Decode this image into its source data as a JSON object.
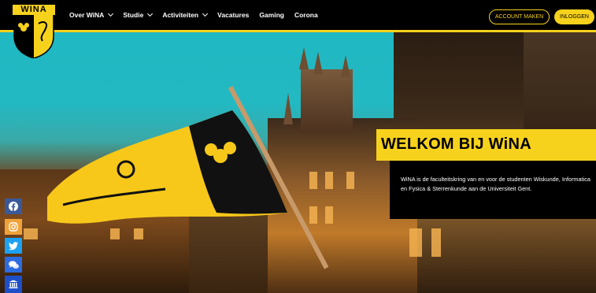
{
  "brand": {
    "name": "WINA",
    "yellow": "#f7d21c",
    "black": "#000000"
  },
  "nav": {
    "items": [
      {
        "label": "Over WiNA",
        "dropdown": true
      },
      {
        "label": "Studie",
        "dropdown": true
      },
      {
        "label": "Activiteiten",
        "dropdown": true
      },
      {
        "label": "Vacatures",
        "dropdown": false
      },
      {
        "label": "Gaming",
        "dropdown": false
      },
      {
        "label": "Corona",
        "dropdown": false
      }
    ],
    "account_label": "ACCOUNT MAKEN",
    "login_label": "INLOGGEN"
  },
  "hero": {
    "title": "WELKOM BIJ WiNA",
    "intro": "WiNA is de faculteitskring van en voor de studenten Wiskunde, Informatica en Fysica & Sterrenkunde aan de Universiteit Gent."
  },
  "social": [
    {
      "icon": "facebook-icon",
      "color": "#3b5998"
    },
    {
      "icon": "instagram-icon",
      "color": "#f0a23a"
    },
    {
      "icon": "twitter-icon",
      "color": "#1da1f2"
    },
    {
      "icon": "chat-icon",
      "color": "#2d6be0"
    },
    {
      "icon": "university-icon",
      "color": "#1e4fc8"
    }
  ]
}
